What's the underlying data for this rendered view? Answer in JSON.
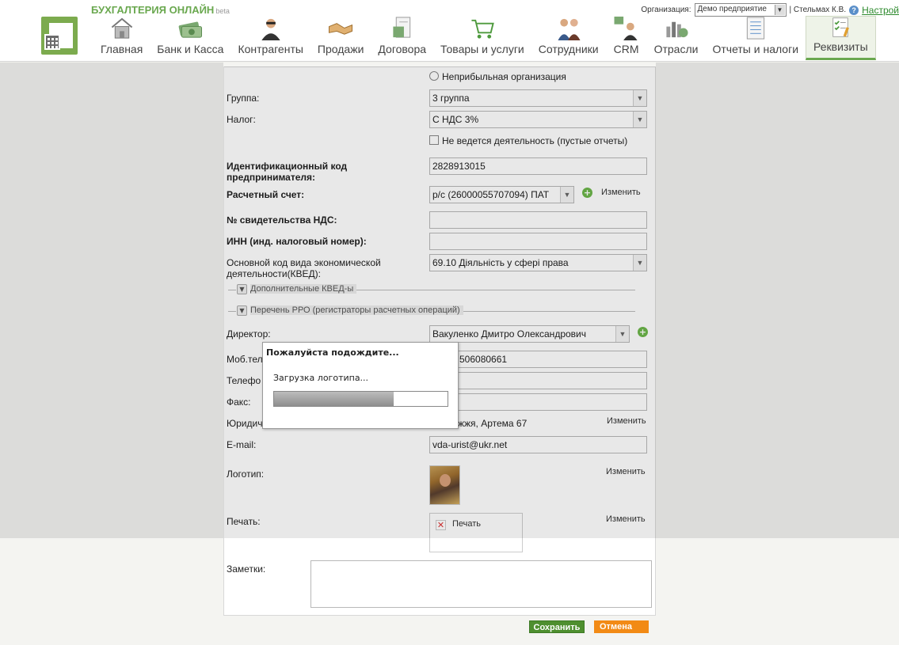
{
  "header": {
    "brand": "БУХГАЛТЕРИЯ ОНЛАЙН",
    "brand_suffix": "beta",
    "org_label": "Организация:",
    "org_value": "Демо предприятие",
    "user": "| Стельмах К.В.",
    "setup_link": "Настрой"
  },
  "nav": [
    {
      "label": "Главная",
      "icon": "house-icon"
    },
    {
      "label": "Банк и Касса",
      "icon": "money-icon"
    },
    {
      "label": "Контрагенты",
      "icon": "agent-icon"
    },
    {
      "label": "Продажи",
      "icon": "handshake-icon"
    },
    {
      "label": "Договора",
      "icon": "contract-icon"
    },
    {
      "label": "Товары и услуги",
      "icon": "cart-icon"
    },
    {
      "label": "Сотрудники",
      "icon": "employees-icon"
    },
    {
      "label": "CRM",
      "icon": "crm-icon"
    },
    {
      "label": "Отрасли",
      "icon": "industry-icon"
    },
    {
      "label": "Отчеты и налоги",
      "icon": "report-icon"
    },
    {
      "label": "Реквизиты",
      "icon": "requisites-icon",
      "active": true
    }
  ],
  "form": {
    "nonprofit_label": "Неприбыльная организация",
    "group_label": "Группа:",
    "group_value": "3 группа",
    "tax_label": "Налог:",
    "tax_value": "С НДС 3%",
    "no_activity_label": "Не ведется деятельность (пустые отчеты)",
    "id_code_label": "Идентификационный код предпринимателя:",
    "id_code_value": "2828913015",
    "account_label": "Расчетный счет:",
    "account_value": "р/с (26000055707094) ПАТ",
    "change": "Изменить",
    "vat_cert_label": "№ свидетельства НДС:",
    "inn_label": "ИНН (инд. налоговый номер):",
    "kved_label": "Основной код вида экономической деятельности(КВЕД):",
    "kved_value": "69.10 Діяльність у сфері права",
    "extra_kved": "Дополнительные КВЕД-ы",
    "rro_list": "Перечень РРО (регистраторы расчетных операций)",
    "director_label": "Директор:",
    "director_value": "Вакуленко Дмитро Олександрович",
    "mobile_label": "Моб.тел",
    "mobile_value": "506080661",
    "phone_label": "Телефо",
    "fax_label": "Факс:",
    "legal_label": "Юридич",
    "legal_value": "жжя, Артема 67",
    "email_label": "E-mail:",
    "email_value": "vda-urist@ukr.net",
    "logo_label": "Логотип:",
    "seal_label": "Печать:",
    "seal_value": "Печать",
    "notes_label": "Заметки:"
  },
  "buttons": {
    "save": "Сохранить",
    "cancel": "Отмена"
  },
  "modal": {
    "title": "Пожалуйста подождите...",
    "message": "Загрузка логотипа...",
    "progress": 0.69
  },
  "colors": {
    "brand_green": "#6aa84f",
    "save_green": "#4e8f2f",
    "cancel_orange": "#f28a15"
  }
}
